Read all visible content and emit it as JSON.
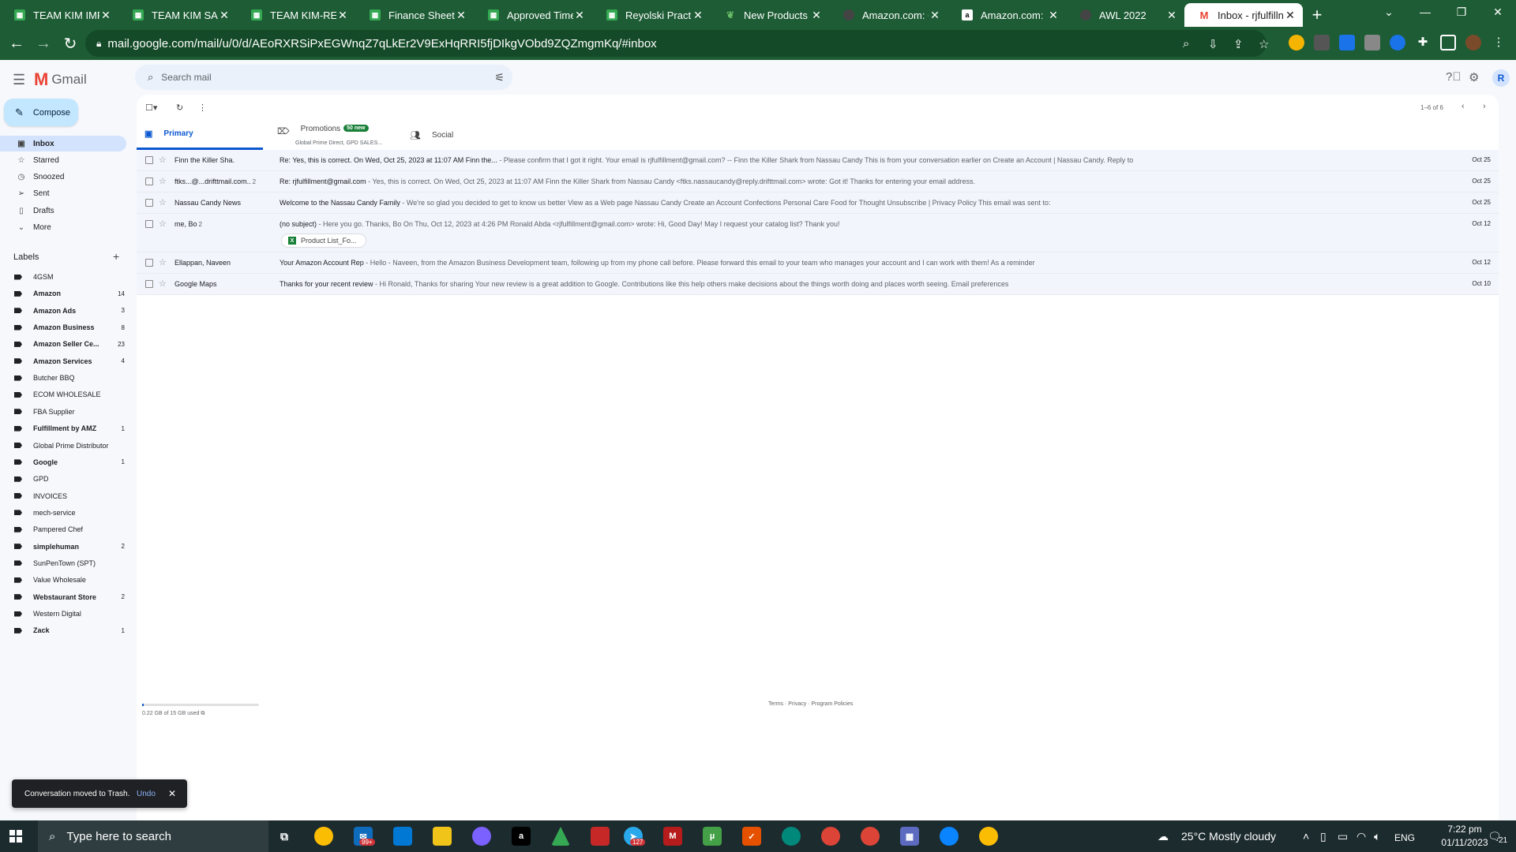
{
  "browser": {
    "tabs": [
      {
        "title": "TEAM KIM IMPO",
        "icon": "sheets-icon"
      },
      {
        "title": "TEAM KIM SALE",
        "icon": "sheets-icon"
      },
      {
        "title": "TEAM KIM-REIN",
        "icon": "sheets-icon"
      },
      {
        "title": "Finance Sheet -",
        "icon": "sheets-icon"
      },
      {
        "title": "Approved Time",
        "icon": "sheets-icon"
      },
      {
        "title": "Reyolski Practic",
        "icon": "sheets-icon"
      },
      {
        "title": "New Products |",
        "icon": "leaf-icon"
      },
      {
        "title": "Amazon.com: O",
        "icon": "dark-circle-icon"
      },
      {
        "title": "Amazon.com: I",
        "icon": "amazon-icon"
      },
      {
        "title": "AWL 2022",
        "icon": "dark-circle-icon"
      },
      {
        "title": "Inbox - rjfulfilln",
        "icon": "gmail-icon"
      }
    ],
    "active_tab_index": 10,
    "url": "mail.google.com/mail/u/0/d/AEoRXRSiPxEGWnqZ7qLkEr2V9ExHqRRI5fjDIkgVObd9ZQZmgmKq/#inbox",
    "theme_color": "#1d5c34"
  },
  "gmail": {
    "app_name": "Gmail",
    "search_placeholder": "Search mail",
    "compose_label": "Compose",
    "avatar_initial": "R",
    "nav": [
      {
        "label": "Inbox",
        "icon": "inbox-icon",
        "selected": true
      },
      {
        "label": "Starred",
        "icon": "star-icon",
        "selected": false
      },
      {
        "label": "Snoozed",
        "icon": "clock-icon",
        "selected": false
      },
      {
        "label": "Sent",
        "icon": "send-icon",
        "selected": false
      },
      {
        "label": "Drafts",
        "icon": "draft-icon",
        "selected": false
      },
      {
        "label": "More",
        "icon": "chevron-down-icon",
        "selected": false
      }
    ],
    "labels_heading": "Labels",
    "labels": [
      {
        "name": "4GSM",
        "count": "",
        "bold": false
      },
      {
        "name": "Amazon",
        "count": "14",
        "bold": true
      },
      {
        "name": "Amazon Ads",
        "count": "3",
        "bold": true
      },
      {
        "name": "Amazon Business",
        "count": "8",
        "bold": true
      },
      {
        "name": "Amazon Seller Ce...",
        "count": "23",
        "bold": true
      },
      {
        "name": "Amazon Services",
        "count": "4",
        "bold": true
      },
      {
        "name": "Butcher BBQ",
        "count": "",
        "bold": false
      },
      {
        "name": "ECOM WHOLESALE",
        "count": "",
        "bold": false
      },
      {
        "name": "FBA Supplier",
        "count": "",
        "bold": false
      },
      {
        "name": "Fulfillment by AMZ",
        "count": "1",
        "bold": true
      },
      {
        "name": "Global Prime Distributor",
        "count": "",
        "bold": false
      },
      {
        "name": "Google",
        "count": "1",
        "bold": true
      },
      {
        "name": "GPD",
        "count": "",
        "bold": false
      },
      {
        "name": "INVOICES",
        "count": "",
        "bold": false
      },
      {
        "name": "mech-service",
        "count": "",
        "bold": false
      },
      {
        "name": "Pampered Chef",
        "count": "",
        "bold": false
      },
      {
        "name": "simplehuman",
        "count": "2",
        "bold": true
      },
      {
        "name": "SunPenTown (SPT)",
        "count": "",
        "bold": false
      },
      {
        "name": "Value Wholesale",
        "count": "",
        "bold": false
      },
      {
        "name": "Webstaurant Store",
        "count": "2",
        "bold": true
      },
      {
        "name": "Western Digital",
        "count": "",
        "bold": false
      },
      {
        "name": "Zack",
        "count": "1",
        "bold": true
      }
    ],
    "pager": "1–6 of 6",
    "tabs": [
      {
        "label": "Primary",
        "icon": "inbox-icon",
        "selected": true
      },
      {
        "label": "Promotions",
        "icon": "tag-icon",
        "badge": "50 new",
        "sub": "Global Prime Direct, GPD SALES..."
      },
      {
        "label": "Social",
        "icon": "people-icon"
      }
    ],
    "emails": [
      {
        "from": "Finn the Killer Sha.",
        "count": "",
        "subject": "Re: Yes, this is correct. On Wed, Oct 25, 2023 at 11:07 AM Finn the...",
        "snippet": " - Please confirm that I got it right. Your email is rjfulfillment@gmail.com? -- Finn the Killer Shark from Nassau Candy This is from your conversation earlier on Create an Account | Nassau Candy. Reply to",
        "date": "Oct 25"
      },
      {
        "from": "ftks...@...drifttmail.com..",
        "count": "2",
        "subject": "Re: rjfulfillment@gmail.com",
        "snippet": " - Yes, this is correct. On Wed, Oct 25, 2023 at 11:07 AM Finn the Killer Shark from Nassau Candy <ftks.nassaucandy@reply.drifttmail.com> wrote: Got it! Thanks for entering your email address.",
        "date": "Oct 25"
      },
      {
        "from": "Nassau Candy News",
        "count": "",
        "subject": "Welcome to the Nassau Candy Family",
        "snippet": " - We're so glad you decided to get to know us better View as a Web page Nassau Candy Create an Account Confections Personal Care Food for Thought Unsubscribe | Privacy Policy This email was sent to:",
        "date": "Oct 25"
      },
      {
        "from": "me, Bo",
        "count": "2",
        "subject": "(no subject)",
        "snippet": " - Here you go. Thanks, Bo On Thu, Oct 12, 2023 at 4:26 PM Ronald Abda <rjfulfillment@gmail.com> wrote: Hi, Good Day! May I request your catalog list? Thank you!",
        "date": "Oct 12",
        "attachment": "Product List_Fo..."
      },
      {
        "from": "Ellappan, Naveen",
        "count": "",
        "subject": "Your Amazon Account Rep",
        "snippet": " - Hello - Naveen, from the Amazon Business Development team, following up from my phone call before. Please forward this email to your team who manages your account and I can work with them! As a reminder",
        "date": "Oct 12"
      },
      {
        "from": "Google Maps",
        "count": "",
        "subject": "Thanks for your recent review",
        "snippet": " - Hi Ronald, Thanks for sharing Your new review is a great addition to Google. Contributions like this help others make decisions about the things worth doing and places worth seeing. Email preferences",
        "date": "Oct 10"
      }
    ],
    "storage_text": "0.22 GB of 15 GB used",
    "storage_fraction": 0.015,
    "footer": "Terms · Privacy · Program Policies",
    "snackbar": {
      "message": "Conversation moved to Trash.",
      "action": "Undo"
    }
  },
  "taskbar": {
    "search_placeholder": "Type here to search",
    "badges": {
      "mail": "99+",
      "telegram": "127"
    },
    "weather": "25°C  Mostly cloudy",
    "language": "ENG",
    "time": "7:22 pm",
    "date": "01/11/2023",
    "notification_count": "21"
  }
}
